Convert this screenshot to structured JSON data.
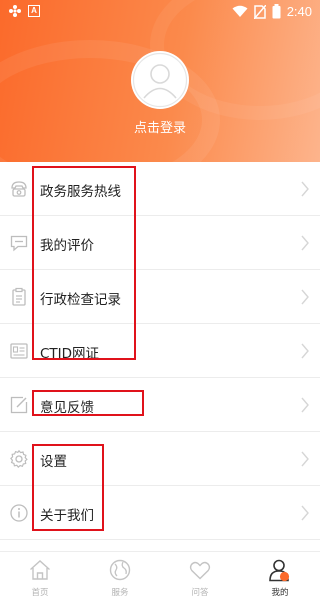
{
  "status_bar": {
    "time": "2:40",
    "left_badge": "A"
  },
  "header": {
    "login_label": "点击登录"
  },
  "menu": {
    "items": [
      {
        "label": "政务服务热线",
        "icon": "phone-icon"
      },
      {
        "label": "我的评价",
        "icon": "comment-icon"
      },
      {
        "label": "行政检查记录",
        "icon": "clipboard-icon"
      },
      {
        "label": "CTID网证",
        "icon": "id-card-icon"
      },
      {
        "label": "意见反馈",
        "icon": "edit-icon"
      },
      {
        "label": "设置",
        "icon": "gear-icon"
      },
      {
        "label": "关于我们",
        "icon": "info-icon"
      }
    ]
  },
  "tabbar": {
    "tabs": [
      {
        "label": "首页",
        "icon": "home-icon"
      },
      {
        "label": "服务",
        "icon": "globe-icon"
      },
      {
        "label": "问答",
        "icon": "heart-icon"
      },
      {
        "label": "我的",
        "icon": "user-icon"
      }
    ]
  },
  "colors": {
    "accent": "#fb7a3c",
    "highlight_box": "#e0121b",
    "text": "#222222",
    "muted": "#b3b3b3"
  }
}
